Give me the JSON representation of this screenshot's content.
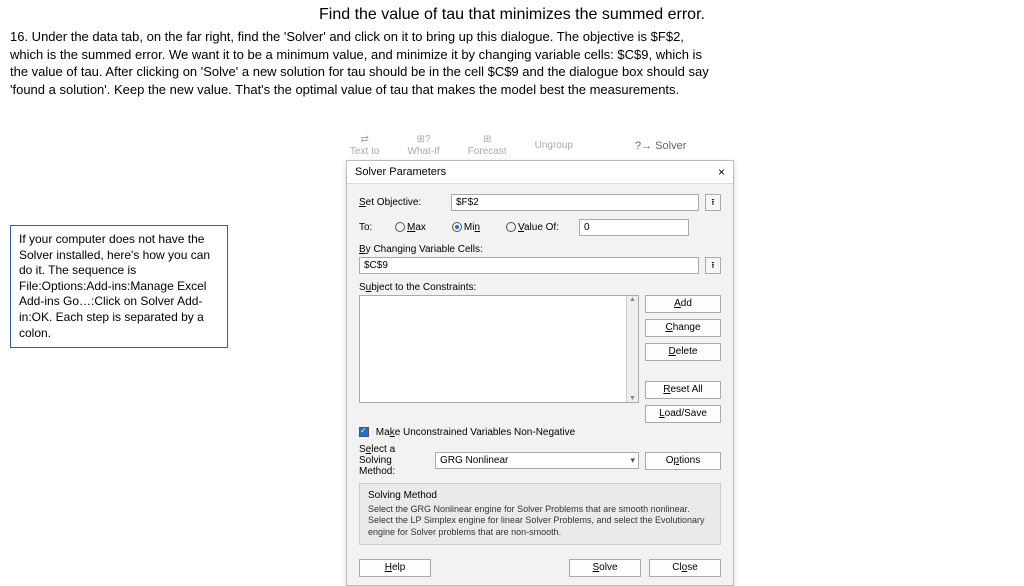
{
  "title": "Find the value of tau that minimizes the summed error.",
  "instruction": "16. Under the data tab, on the far right, find the 'Solver' and click on it to bring up this dialogue.  The objective is $F$2, which is the summed error.  We want it to be a minimum value, and minimize it by changing variable cells: $C$9, which is the value of tau. After clicking on 'Solve' a new solution for tau should be in the cell $C$9 and the dialogue box should say 'found a solution'.  Keep the new value.  That's the optimal value of tau that makes the model best the measurements.",
  "note": "If your computer does not have the Solver installed, here's how you can do it.  The sequence is File:Options:Add-ins:Manage Excel Add-ins Go…:Click on Solver Add-in:OK.  Each step is separated by a colon.",
  "ribbon": {
    "text_to": "Text to",
    "whatif": "What-If",
    "forecast": "Forecast",
    "ungroup": "Ungroup",
    "solver": "?→ Solver"
  },
  "dialog": {
    "title": "Solver Parameters",
    "set_objective_label": "Set Objective:",
    "objective_value": "$F$2",
    "to_label": "To:",
    "radio_max": "Max",
    "radio_min": "Min",
    "radio_valueof": "Value Of:",
    "valueof_field": "0",
    "by_changing_label": "By Changing Variable Cells:",
    "changing_value": "$C$9",
    "subject_label": "Subject to the Constraints:",
    "buttons": {
      "add": "Add",
      "change": "Change",
      "delete": "Delete",
      "reset": "Reset All",
      "loadsave": "Load/Save",
      "options": "Options"
    },
    "nonneg_label": "Make Unconstrained Variables Non-Negative",
    "method_label": "Select a Solving Method:",
    "method_value": "GRG Nonlinear",
    "desc_head": "Solving Method",
    "desc_text": "Select the GRG Nonlinear engine for Solver Problems that are smooth nonlinear. Select the LP Simplex engine for linear Solver Problems, and select the Evolutionary engine for Solver problems that are non-smooth.",
    "footer": {
      "help": "Help",
      "solve": "Solve",
      "close": "Close"
    }
  }
}
